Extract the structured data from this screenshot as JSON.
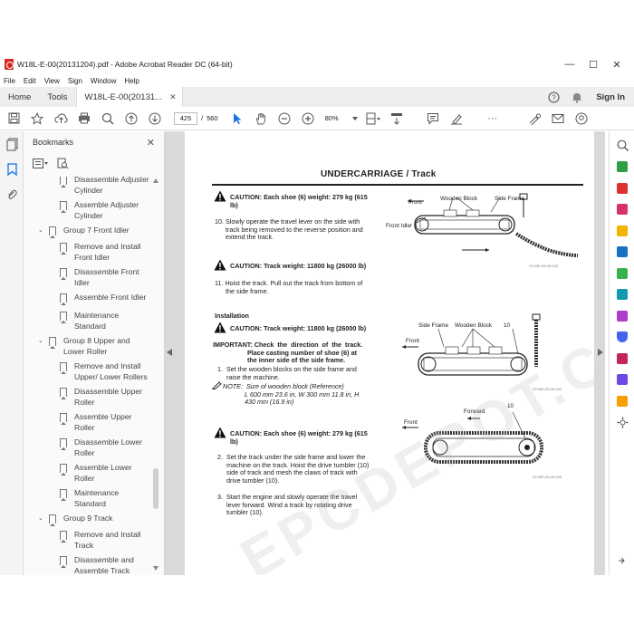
{
  "window": {
    "title": "W18L-E-00(20131204).pdf - Adobe Acrobat Reader DC (64-bit)",
    "controls": [
      "—",
      "☐",
      "✕"
    ]
  },
  "menu": [
    "File",
    "Edit",
    "View",
    "Sign",
    "Window",
    "Help"
  ],
  "tabs": {
    "home": "Home",
    "tools": "Tools",
    "doc": "W18L-E-00(20131...",
    "close": "✕",
    "sign_in": "Sign In"
  },
  "toolbar": {
    "page_current": "425",
    "page_sep": "/",
    "page_total": "560",
    "zoom": "80%",
    "more": "···"
  },
  "bookmarks": {
    "header": "Bookmarks",
    "close": "✕",
    "items": [
      {
        "label": "Disassemble Adjuster\nCylinder",
        "type": "leaf"
      },
      {
        "label": "Assemble Adjuster\nCylinder",
        "type": "leaf"
      },
      {
        "label": "Group 7 Front Idler",
        "type": "group"
      },
      {
        "label": "Remove and Install\nFront Idler",
        "type": "leaf"
      },
      {
        "label": "Disassemble Front\nIdler",
        "type": "leaf"
      },
      {
        "label": "Assemble Front Idler",
        "type": "leaf"
      },
      {
        "label": "Maintenance\nStandard",
        "type": "leaf"
      },
      {
        "label": "Group 8 Upper and\nLower Roller",
        "type": "group"
      },
      {
        "label": "Remove and Install\nUpper/ Lower Rollers",
        "type": "leaf"
      },
      {
        "label": "Disassemble Upper\nRoller",
        "type": "leaf"
      },
      {
        "label": "Assemble Upper\nRoller",
        "type": "leaf"
      },
      {
        "label": "Disassemble Lower\nRoller",
        "type": "leaf"
      },
      {
        "label": "Assemble Lower\nRoller",
        "type": "leaf"
      },
      {
        "label": "Maintenance\nStandard",
        "type": "leaf"
      },
      {
        "label": "Group 9 Track",
        "type": "group"
      },
      {
        "label": "Remove and Install\nTrack",
        "type": "leaf"
      },
      {
        "label": "Disassemble and\nAssemble Track",
        "type": "leaf"
      }
    ]
  },
  "page": {
    "title": "UNDERCARRIAGE / Track",
    "caution1": "CAUTION:  Each shoe (6) weight: 279 kg (615\nlb)",
    "step10": "10. Slowly operate the travel lever on the side with\n      track being removed to the reverse position and\n      extend the track.",
    "caution2": "CAUTION:  Track weight: 11800 kg (26000 lb)",
    "step11": "11. Hoist the track. Pull out the track from bottom of\n      the side frame.",
    "installation": "Installation",
    "caution3": "CAUTION:  Track weight: 11800 kg (26000 lb)",
    "important": "IMPORTANT: Check  the  direction  of  the  track.\n                   Place casting number of shoe (6) at\n                   the inner side of the side frame.",
    "step1": "1.  Set the wooden blocks on the side frame and\n     raise the machine.",
    "note": "NOTE:  Size of wooden block (Reference)\n            L 600 mm 23.6 in, W 300 mm 11.8 in, H\n            430 mm (16.9 in)",
    "caution4": "CAUTION:  Each shoe (6) weight: 279 kg (615\nlb)",
    "step2": "2.  Set the track under the side frame and lower the\n     machine on the track. Hoist the drive tumbler (10)\n     side of track and mesh the claws of track with\n     drive tumbler (10).",
    "step3": "3.  Start the engine and slowly operate the travel\n     lever forward. Wind a track by rotating drive\n     tumbler (10).",
    "fig1": {
      "front": "Front",
      "wooden_block": "Wooden Block",
      "side_frame": "Side Frame",
      "front_idler": "Front Idler",
      "caption": "SY18E-03-09-003"
    },
    "fig2": {
      "side_frame": "Side Frame",
      "wooden_block": "Wooden Block",
      "num": "10",
      "front": "Front",
      "caption": "SY18E-03-09-004"
    },
    "fig3": {
      "forward": "Forward",
      "num": "10",
      "front": "Front",
      "caption": "SY18E-03-09-005"
    }
  },
  "watermark": "EPCDEPOT.COM"
}
